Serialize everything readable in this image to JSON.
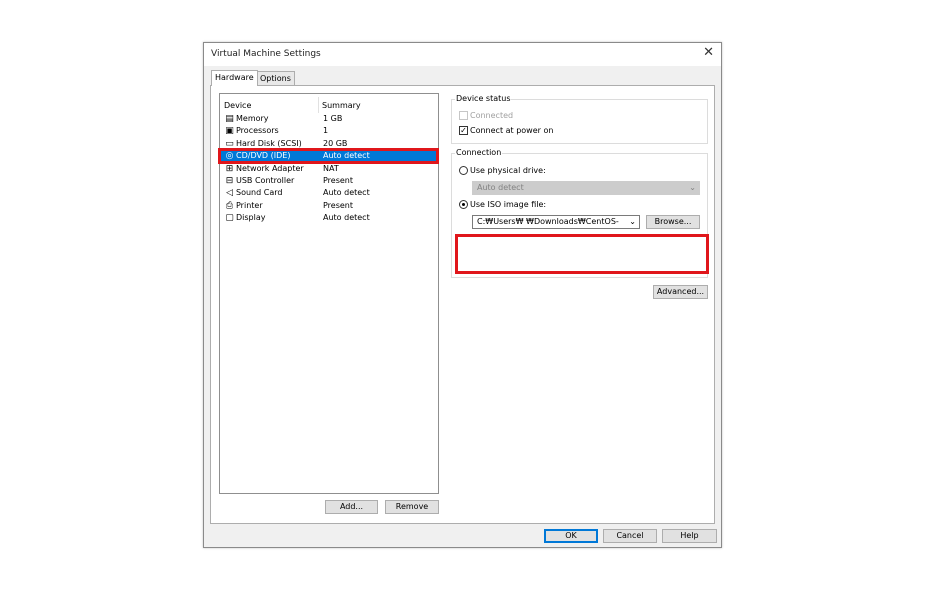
{
  "window": {
    "title": "Virtual Machine Settings",
    "close_glyph": "✕"
  },
  "tabs": [
    {
      "label": "Hardware"
    },
    {
      "label": "Options"
    }
  ],
  "device_list": {
    "headers": {
      "device": "Device",
      "summary": "Summary"
    },
    "rows": [
      {
        "icon": "memory-icon",
        "glyph": "▤",
        "name": "Memory",
        "summary": "1 GB"
      },
      {
        "icon": "processor-icon",
        "glyph": "▣",
        "name": "Processors",
        "summary": "1"
      },
      {
        "icon": "hard-disk-icon",
        "glyph": "▭",
        "name": "Hard Disk (SCSI)",
        "summary": "20 GB"
      },
      {
        "icon": "cd-dvd-icon",
        "glyph": "◎",
        "name": "CD/DVD (IDE)",
        "summary": "Auto detect",
        "selected": true
      },
      {
        "icon": "network-icon",
        "glyph": "⊞",
        "name": "Network Adapter",
        "summary": "NAT"
      },
      {
        "icon": "usb-icon",
        "glyph": "⊟",
        "name": "USB Controller",
        "summary": "Present"
      },
      {
        "icon": "sound-icon",
        "glyph": "◁",
        "name": "Sound Card",
        "summary": "Auto detect"
      },
      {
        "icon": "printer-icon",
        "glyph": "⎙",
        "name": "Printer",
        "summary": "Present"
      },
      {
        "icon": "display-icon",
        "glyph": "▢",
        "name": "Display",
        "summary": "Auto detect"
      }
    ],
    "add_label": "Add...",
    "remove_label": "Remove"
  },
  "device_status": {
    "title": "Device status",
    "connected": {
      "label": "Connected",
      "checked": false,
      "disabled": true
    },
    "connect_at_power_on": {
      "label": "Connect at power on",
      "checked": true
    }
  },
  "connection": {
    "title": "Connection",
    "physical_drive": {
      "label": "Use physical drive:",
      "selected": false
    },
    "drive_combo_value": "Auto detect",
    "iso_image": {
      "label": "Use ISO image file:",
      "selected": true
    },
    "iso_path": "C:₩Users₩           ₩Downloads₩CentOS-",
    "browse_label": "Browse..."
  },
  "advanced_label": "Advanced...",
  "footer": {
    "ok_label": "OK",
    "cancel_label": "Cancel",
    "help_label": "Help"
  },
  "colors": {
    "selection": "#0078d7",
    "highlight_box": "#e0161b"
  }
}
